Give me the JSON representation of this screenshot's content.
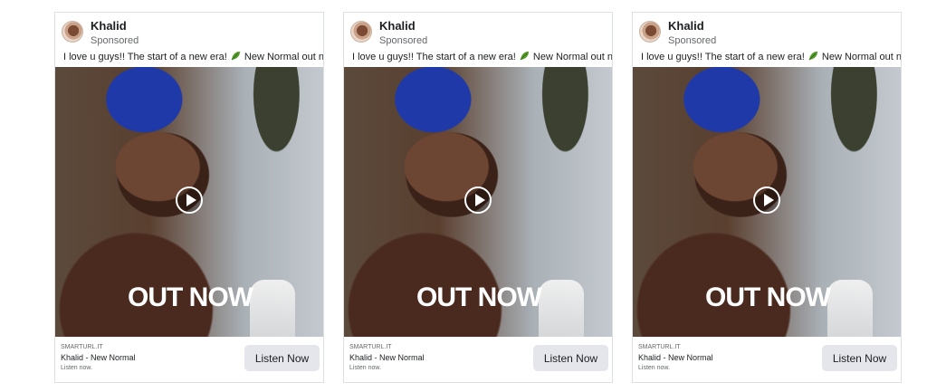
{
  "ads": [
    {
      "page_name": "Khalid",
      "sponsored_label": "Sponsored",
      "caption_before": "I love u guys!! The start of a new era!",
      "caption_emoji_icon": "leaf-icon",
      "caption_after": "New Normal out now",
      "media_overlay_text": "OUT NOW",
      "link_domain": "SMARTURL.IT",
      "link_title": "Khalid - New Normal",
      "link_description": "Listen now.",
      "cta_label": "Listen Now"
    },
    {
      "page_name": "Khalid",
      "sponsored_label": "Sponsored",
      "caption_before": "I love u guys!! The start of a new era!",
      "caption_emoji_icon": "leaf-icon",
      "caption_after": "New Normal out now",
      "media_overlay_text": "OUT NOW",
      "link_domain": "SMARTURL.IT",
      "link_title": "Khalid - New Normal",
      "link_description": "Listen now.",
      "cta_label": "Listen Now"
    },
    {
      "page_name": "Khalid",
      "sponsored_label": "Sponsored",
      "caption_before": "I love u guys!! The start of a new era!",
      "caption_emoji_icon": "leaf-icon",
      "caption_after": "New Normal out now",
      "media_overlay_text": "OUT NOW",
      "link_domain": "SMARTURL.IT",
      "link_title": "Khalid - New Normal",
      "link_description": "Listen now.",
      "cta_label": "Listen Now"
    }
  ],
  "colors": {
    "text_primary": "#1c1e21",
    "text_secondary": "#65676b",
    "cta_background": "#e4e6eb",
    "hair_blue": "#1f3aa8"
  }
}
